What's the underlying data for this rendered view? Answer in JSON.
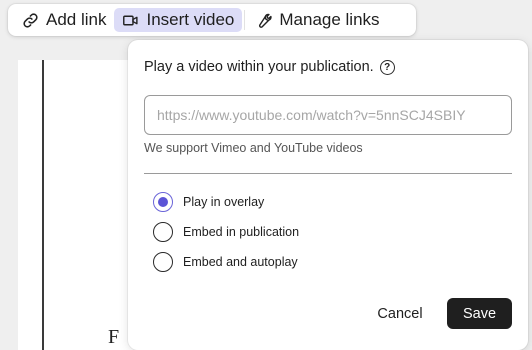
{
  "toolbar": {
    "add_link": {
      "label": "Add link",
      "icon": "link-icon"
    },
    "insert_video": {
      "label": "Insert video",
      "icon": "video-camera-icon"
    },
    "manage_links": {
      "label": "Manage links",
      "icon": "wrench-icon"
    }
  },
  "popover": {
    "title": "Play a video within your publication.",
    "help_icon": "?",
    "url_input": {
      "value": "",
      "placeholder": "https://www.youtube.com/watch?v=5nnSCJ4SBIY"
    },
    "support_text": "We support Vimeo and YouTube videos",
    "options": [
      {
        "label": "Play in overlay",
        "checked": true
      },
      {
        "label": "Embed in publication",
        "checked": false
      },
      {
        "label": "Embed and autoplay",
        "checked": false
      }
    ],
    "cancel_label": "Cancel",
    "save_label": "Save"
  },
  "document": {
    "glyph": "F"
  },
  "colors": {
    "accent": "#5b54d6",
    "active_tab_bg": "#dcdcf7",
    "primary_button": "#1f1f1f"
  }
}
